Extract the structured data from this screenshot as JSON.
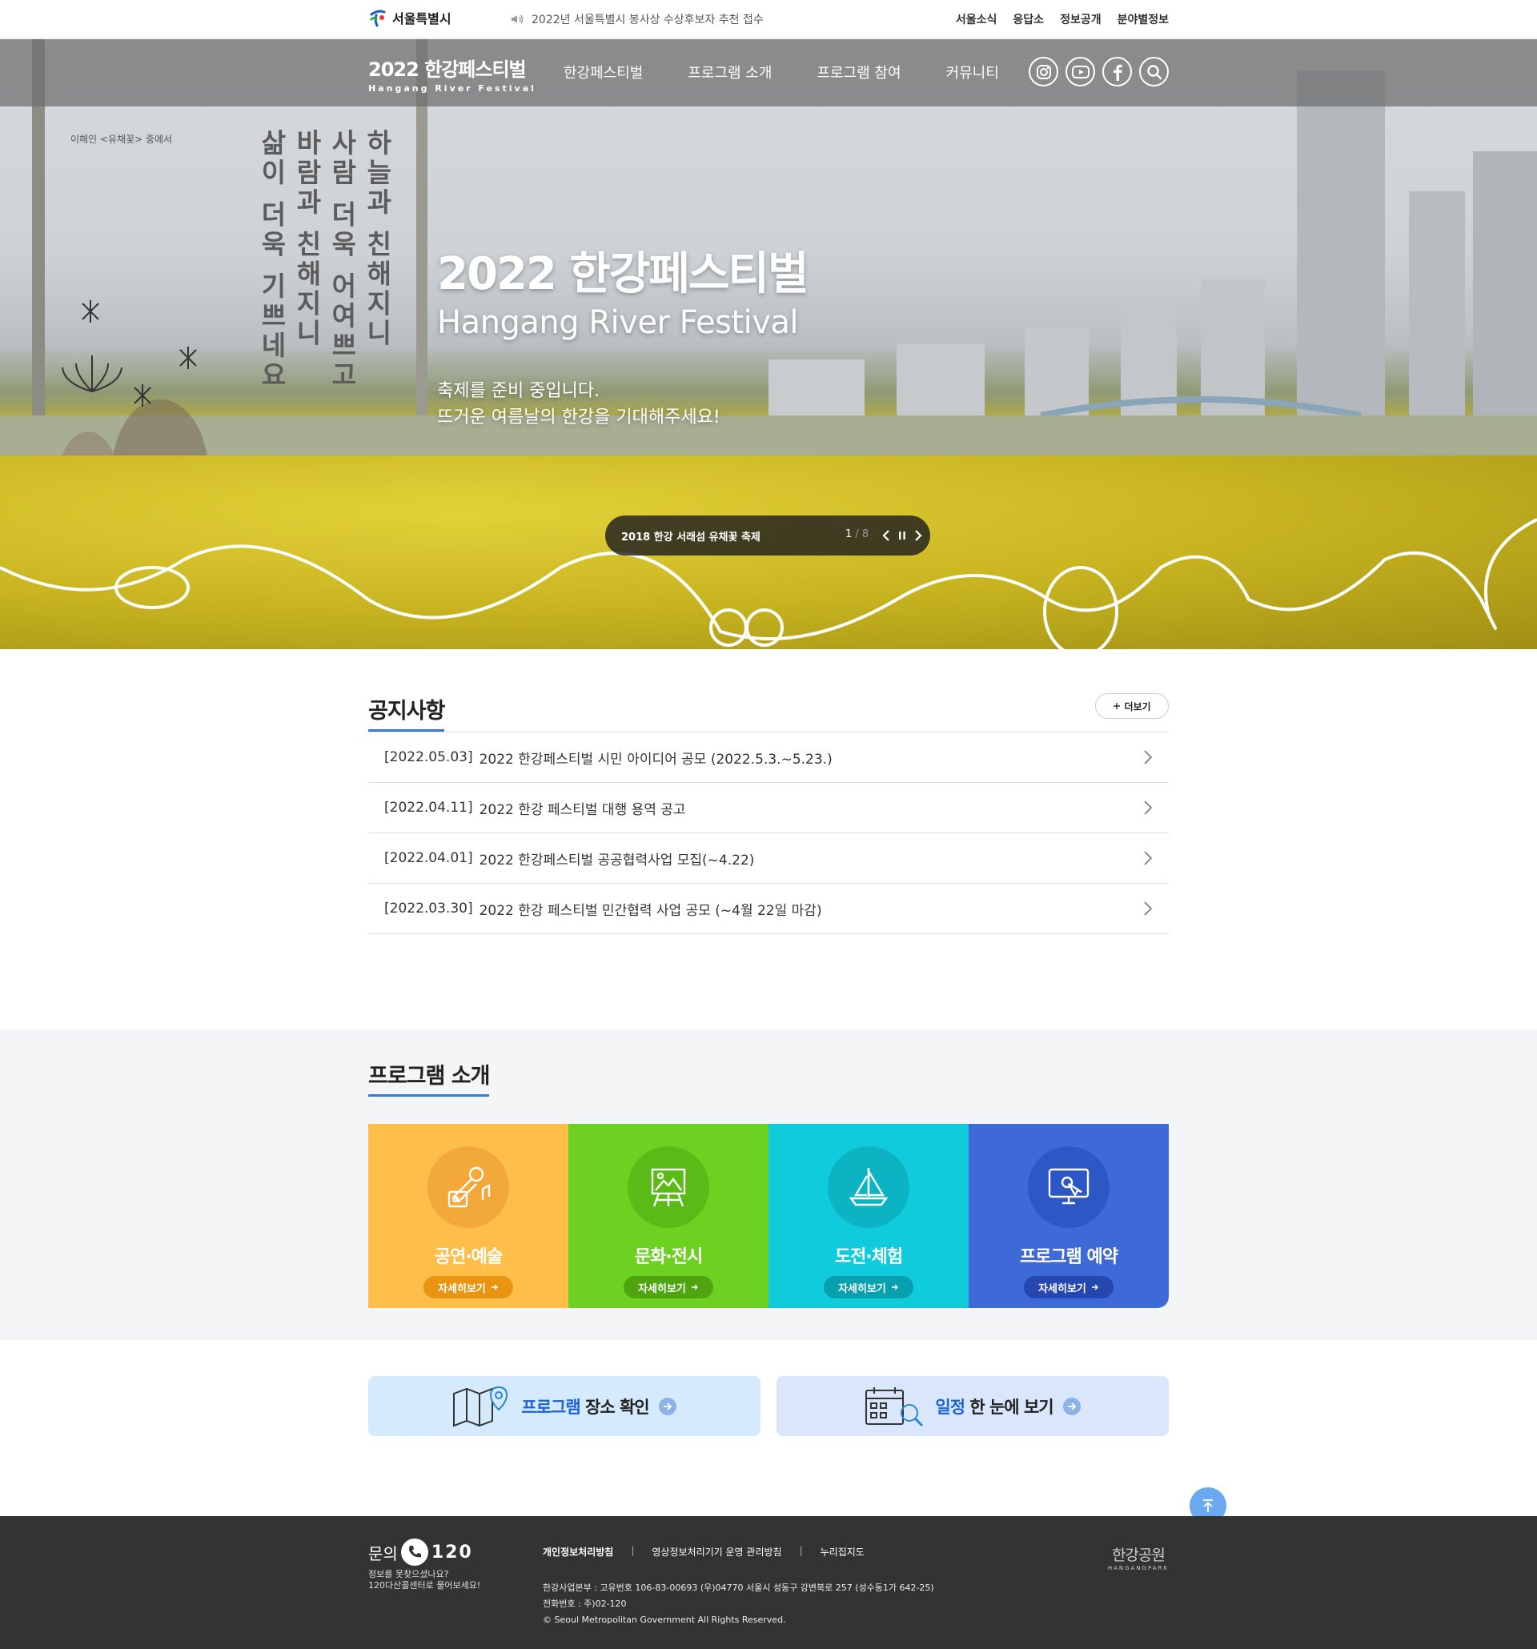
{
  "topbar": {
    "logo_label": "서울특별시",
    "ticker": "2022년 서울특별시 봉사상 수상후보자 추천 접수",
    "links": [
      "서울소식",
      "응답소",
      "정보공개",
      "분야별정보"
    ]
  },
  "nav": {
    "brand_ko": "2022 한강페스티벌",
    "brand_en": "Hangang River Festival",
    "menu": [
      "한강페스티벌",
      "프로그램 소개",
      "프로그램 참여",
      "커뮤니티"
    ],
    "sns_icons": [
      "instagram-icon",
      "youtube-icon",
      "facebook-icon",
      "search-icon"
    ]
  },
  "hero": {
    "poem_lines": [
      "하늘과 친해지니",
      "사람 더욱 어여쁘고",
      "바람과 친해지니",
      "삶이 더욱 기쁘네요"
    ],
    "poem_credit": "이해인 <유채꽃> 중에서",
    "title_ko": "2022 한강페스티벌",
    "title_en": "Hangang River Festival",
    "desc_line1": "축제를 준비 중입니다.",
    "desc_line2": "뜨거운 여름날의 한강을 기대해주세요!",
    "slide_caption": "2018 한강 서래섬 유채꽃 축제",
    "slide_current": "1",
    "slide_total": " / 8"
  },
  "notice": {
    "title": "공지사항",
    "more_label": "더보기",
    "items": [
      {
        "date": "[2022.05.03]",
        "text": "2022 한강페스티벌 시민 아이디어 공모 (2022.5.3.~5.23.)"
      },
      {
        "date": "[2022.04.11]",
        "text": "2022 한강 페스티벌 대행 용역 공고"
      },
      {
        "date": "[2022.04.01]",
        "text": "2022 한강페스티벌 공공협력사업 모집(~4.22)"
      },
      {
        "date": "[2022.03.30]",
        "text": "2022 한강 페스티벌 민간협력 사업 공모 (~4월 22일 마감)"
      }
    ]
  },
  "program": {
    "title": "프로그램 소개",
    "cards": [
      {
        "title": "공연·예술",
        "button": "자세히보기",
        "bg": "#ffbd4a",
        "circle": "#f2a93a",
        "pill": "#e89512",
        "icon": "microphone-icon"
      },
      {
        "title": "문화·전시",
        "button": "자세히보기",
        "bg": "#6cd121",
        "circle": "#5bbb16",
        "pill": "#4ea510",
        "icon": "easel-icon"
      },
      {
        "title": "도전·체험",
        "button": "자세히보기",
        "bg": "#0fcbdc",
        "circle": "#0cb4c3",
        "pill": "#08a0ae",
        "icon": "sailboat-icon"
      },
      {
        "title": "프로그램 예약",
        "button": "자세히보기",
        "bg": "#3e6ad8",
        "circle": "#2d57c4",
        "pill": "#2548b0",
        "icon": "monitor-touch-icon"
      }
    ]
  },
  "quick": [
    {
      "highlight": "프로그램",
      "rest": " 장소 확인",
      "bg": "#d5ebfd",
      "icon": "map-pin-icon"
    },
    {
      "highlight": "일정",
      "rest": " 한 눈에 보기",
      "bg": "#d9e6fb",
      "icon": "calendar-search-icon"
    }
  ],
  "footer": {
    "contact_label": "문의",
    "contact_number": "120",
    "contact_sub1": "정보를 못찾으셨나요?",
    "contact_sub2": "120다산콜센터로 물어보세요!",
    "links": [
      "개인정보처리방침",
      "영상정보처리기기 운영 관리방침",
      "누리집지도"
    ],
    "address": "한강사업본부 : 고유번호 106-83-00693 (우)04770 서울시 성동구 강변북로 257 (성수동1가 642-25)",
    "tel": "전화번호 : 주)02-120",
    "copyright": "© Seoul Metropolitan Government All Rights Reserved.",
    "park_logo_ko": "한강공원",
    "park_logo_en": "HANGANGPARK"
  },
  "colors": {
    "accent": "#3a7ad6",
    "footer_bg": "#333333",
    "program_bg": "#f4f5f6"
  }
}
